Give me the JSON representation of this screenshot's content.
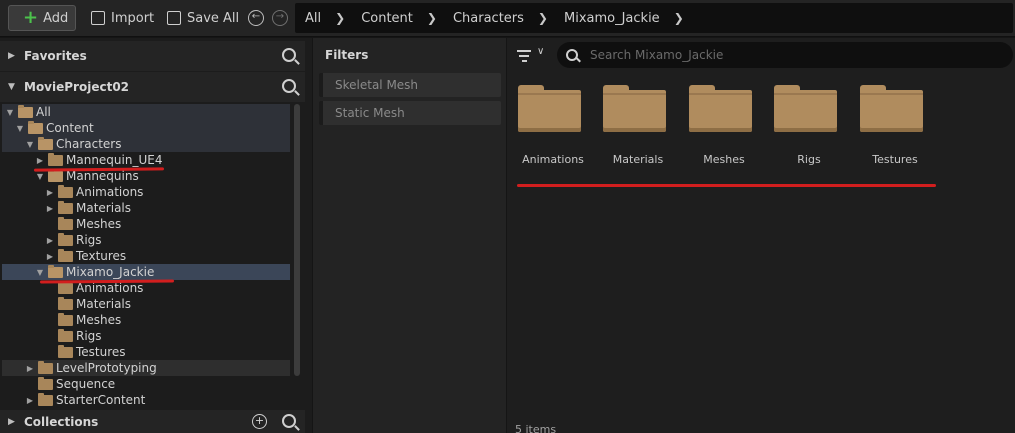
{
  "toolbar": {
    "add_label": "Add",
    "import_label": "Import",
    "saveall_label": "Save All"
  },
  "breadcrumb": [
    "All",
    "Content",
    "Characters",
    "Mixamo_Jackie"
  ],
  "left_panel": {
    "favorites_label": "Favorites",
    "project_label": "MovieProject02",
    "collections_label": "Collections",
    "tree": [
      {
        "label": "All"
      },
      {
        "label": "Content"
      },
      {
        "label": "Characters"
      },
      {
        "label": "Mannequin_UE4"
      },
      {
        "label": "Mannequins"
      },
      {
        "label": "Animations"
      },
      {
        "label": "Materials"
      },
      {
        "label": "Meshes"
      },
      {
        "label": "Rigs"
      },
      {
        "label": "Textures"
      },
      {
        "label": "Mixamo_Jackie"
      },
      {
        "label": "Animations"
      },
      {
        "label": "Materials"
      },
      {
        "label": "Meshes"
      },
      {
        "label": "Rigs"
      },
      {
        "label": "Testures"
      },
      {
        "label": "LevelPrototyping"
      },
      {
        "label": "Sequence"
      },
      {
        "label": "StarterContent"
      }
    ]
  },
  "filters": {
    "title": "Filters",
    "items": [
      "Skeletal Mesh",
      "Static Mesh"
    ]
  },
  "content": {
    "search_placeholder": "Search Mixamo_Jackie",
    "folders": [
      "Animations",
      "Materials",
      "Meshes",
      "Rigs",
      "Testures"
    ],
    "item_count": "5 items"
  },
  "colors": {
    "folder": "#b08c5e",
    "annotation_red": "#d21e1e",
    "selection": "#3b4658",
    "add_plus": "#4cc24c"
  }
}
